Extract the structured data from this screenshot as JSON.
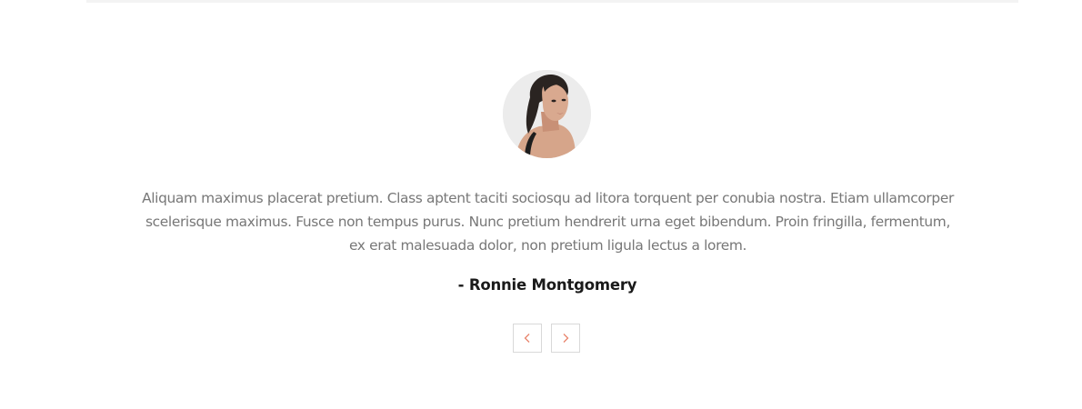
{
  "testimonial": {
    "avatar_icon": "person-portrait-icon",
    "quote": "Aliquam maximus placerat pretium. Class aptent taciti sociosqu ad litora torquent per conubia nostra. Etiam ullamcorper scelerisque maximus. Fusce non tempus purus. Nunc pretium hendrerit urna eget bibendum. Proin fringilla, fermentum, ex erat malesuada dolor, non pretium ligula lectus a lorem.",
    "author": "- Ronnie Montgomery"
  },
  "navigation": {
    "prev_icon": "chevron-left-icon",
    "next_icon": "chevron-right-icon"
  },
  "colors": {
    "accent": "#e8836b",
    "text": "#777777",
    "author": "#1a1a1a",
    "border": "#d9d9d9"
  }
}
